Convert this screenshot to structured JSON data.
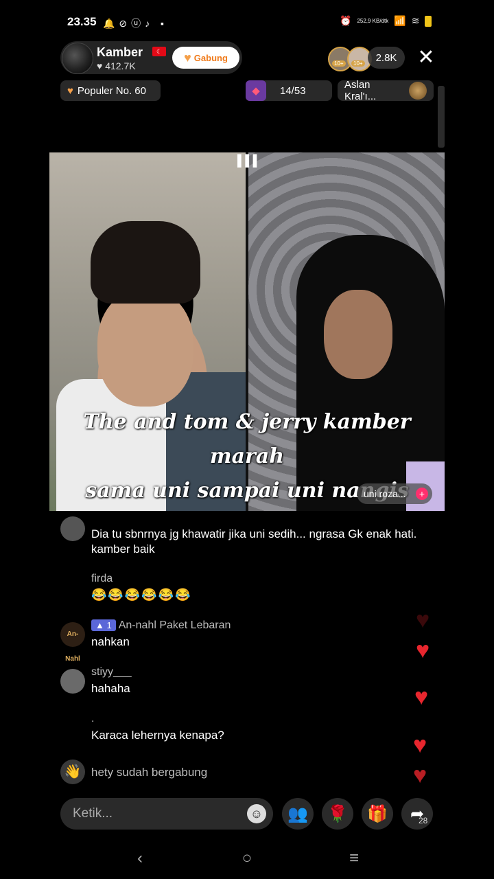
{
  "status_bar": {
    "time": "23.35",
    "net_speed": "252,9 KB/dtk",
    "net_type": "4G"
  },
  "host": {
    "name": "Kamber",
    "likes": "♥ 412.7K",
    "join_label": "Gabung"
  },
  "viewers": {
    "badge": "10+",
    "count": "2.8K"
  },
  "badges": {
    "popular": "Populer No. 60",
    "rank": "14/53",
    "aslan": "Aslan Kral'ı..."
  },
  "video": {
    "caption_line1": "The and tom & jerry kamber marah",
    "caption_line2": "sama uni sampai uni nangis",
    "guest_label": "uni roza..."
  },
  "comments": [
    {
      "user": "",
      "text": "Dia tu sbnrnya jg khawatir jika uni sedih...  ngrasa Gk enak hati.  kamber baik"
    },
    {
      "user": "firda",
      "text": "😂😂😂😂😂😂"
    },
    {
      "user": "An-nahl Paket Lebaran",
      "level": "1",
      "text": "nahkan"
    },
    {
      "user": "stiyy___",
      "text": "hahaha"
    },
    {
      "user": ".",
      "text": "Karaca lehernya kenapa?"
    }
  ],
  "join_notice": {
    "user": "hety",
    "text": "sudah bergabung"
  },
  "input": {
    "placeholder": "Ketik..."
  },
  "share_count": "28",
  "colors": {
    "accent": "#ff2f6e",
    "heart": "#e8262e",
    "level_badge": "#5b67d8",
    "join_text": "#f07a1a"
  }
}
